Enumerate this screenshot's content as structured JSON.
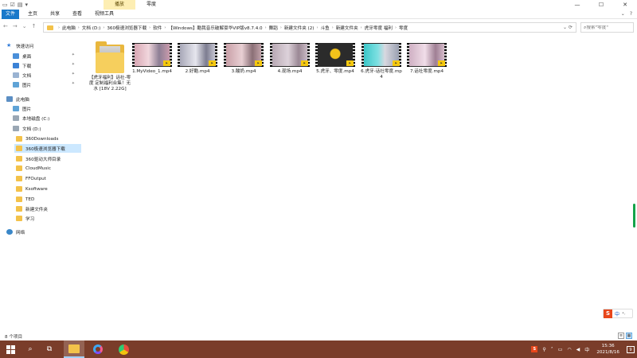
{
  "titlebar": {
    "context_tab": "播放",
    "title": "零度",
    "controls": [
      "—",
      "☐",
      "✕"
    ]
  },
  "ribbon": {
    "tabs": [
      "文件",
      "主页",
      "共享",
      "查看",
      "视频工具"
    ]
  },
  "address": {
    "crumbs": [
      "此电脑",
      "文档 (D:)",
      "360极速浏览器下载",
      "软件",
      "【Windows】酷我音乐破解豪华VIP版v8.7.4.0",
      "舞蹈",
      "新建文件夹 (2)",
      "斗鱼",
      "新建文件夹",
      "虎牙零度 福利",
      "零度"
    ],
    "search_placeholder": "搜索\"零度\""
  },
  "nav": {
    "quick_access": "快速访问",
    "desktop": "桌面",
    "downloads": "下载",
    "documents": "文档",
    "pictures": "图片",
    "this_pc": "此电脑",
    "pc_pictures": "图片",
    "local_c": "本地磁盘 (C:)",
    "docs_d": "文档 (D:)",
    "folders": [
      "360Downloads",
      "360极速浏览器下载",
      "360驱动大师目录",
      "CloudMusic",
      "FFOutput",
      "Ksoftware",
      "TED",
      "新建文件夹",
      "学习"
    ],
    "network": "网络"
  },
  "files": {
    "folder": "【虎牙福利】话社-零度 定制福利合集！无水 [18V 2.22G]",
    "videos": [
      "1.MyVideo_1.mp4",
      "2.好酷.mp4",
      "3.酸奶.mp4",
      "4.现场.mp4",
      "5.虎牙、零度.mp4",
      "6.虎牙-话社零度.mp4",
      "7.话社零度.mp4"
    ]
  },
  "status": {
    "count": "8 个项目"
  },
  "ime": {
    "logo": "S",
    "lang": "中",
    "more": "•,"
  },
  "taskbar": {
    "time": "15:36",
    "date": "2021/8/16",
    "notifications": "9",
    "tray_lang": "中"
  }
}
